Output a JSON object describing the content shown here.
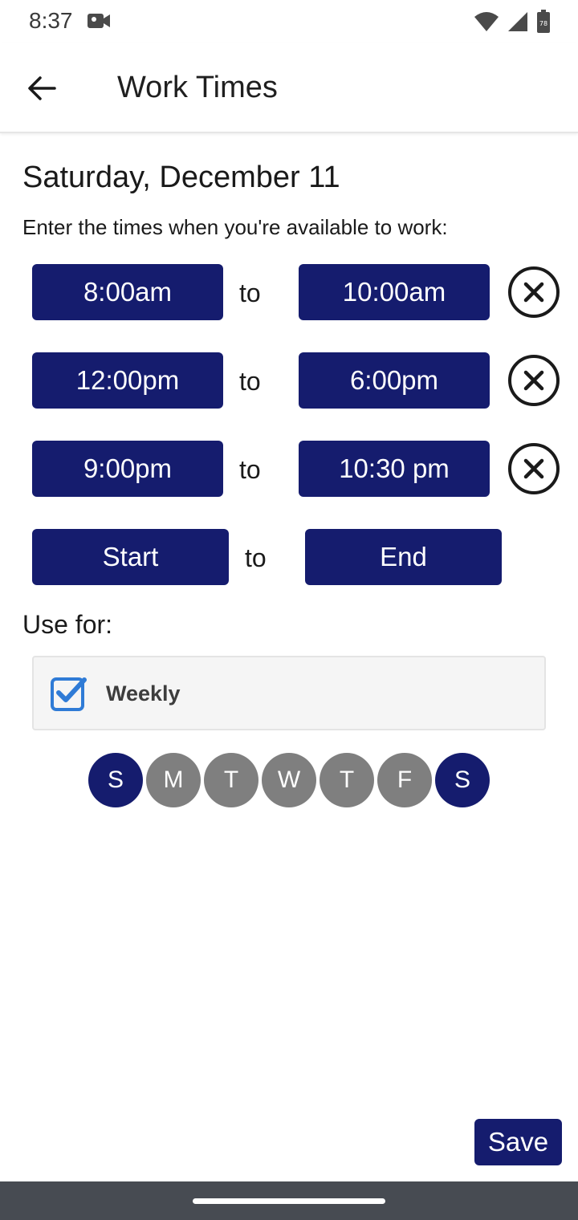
{
  "status_bar": {
    "time": "8:37",
    "battery_level": "78"
  },
  "app_bar": {
    "title": "Work Times"
  },
  "date_heading": "Saturday, December 11",
  "instructions": "Enter the times when you're available to work:",
  "time_ranges": [
    {
      "start": "8:00am",
      "to": "to",
      "end": "10:00am"
    },
    {
      "start": "12:00pm",
      "to": "to",
      "end": "6:00pm"
    },
    {
      "start": "9:00pm",
      "to": "to",
      "end": "10:30 pm"
    }
  ],
  "new_range": {
    "start": "Start",
    "to": "to",
    "end": "End"
  },
  "use_for": {
    "label": "Use for:",
    "weekly_label": "Weekly",
    "weekly_checked": true
  },
  "days": [
    {
      "letter": "S",
      "selected": true
    },
    {
      "letter": "M",
      "selected": false
    },
    {
      "letter": "T",
      "selected": false
    },
    {
      "letter": "W",
      "selected": false
    },
    {
      "letter": "T",
      "selected": false
    },
    {
      "letter": "F",
      "selected": false
    },
    {
      "letter": "S",
      "selected": true
    }
  ],
  "save_label": "Save",
  "colors": {
    "primary": "#151c6e",
    "day_inactive": "#7f7f7f",
    "check_blue": "#2f7bd6"
  }
}
